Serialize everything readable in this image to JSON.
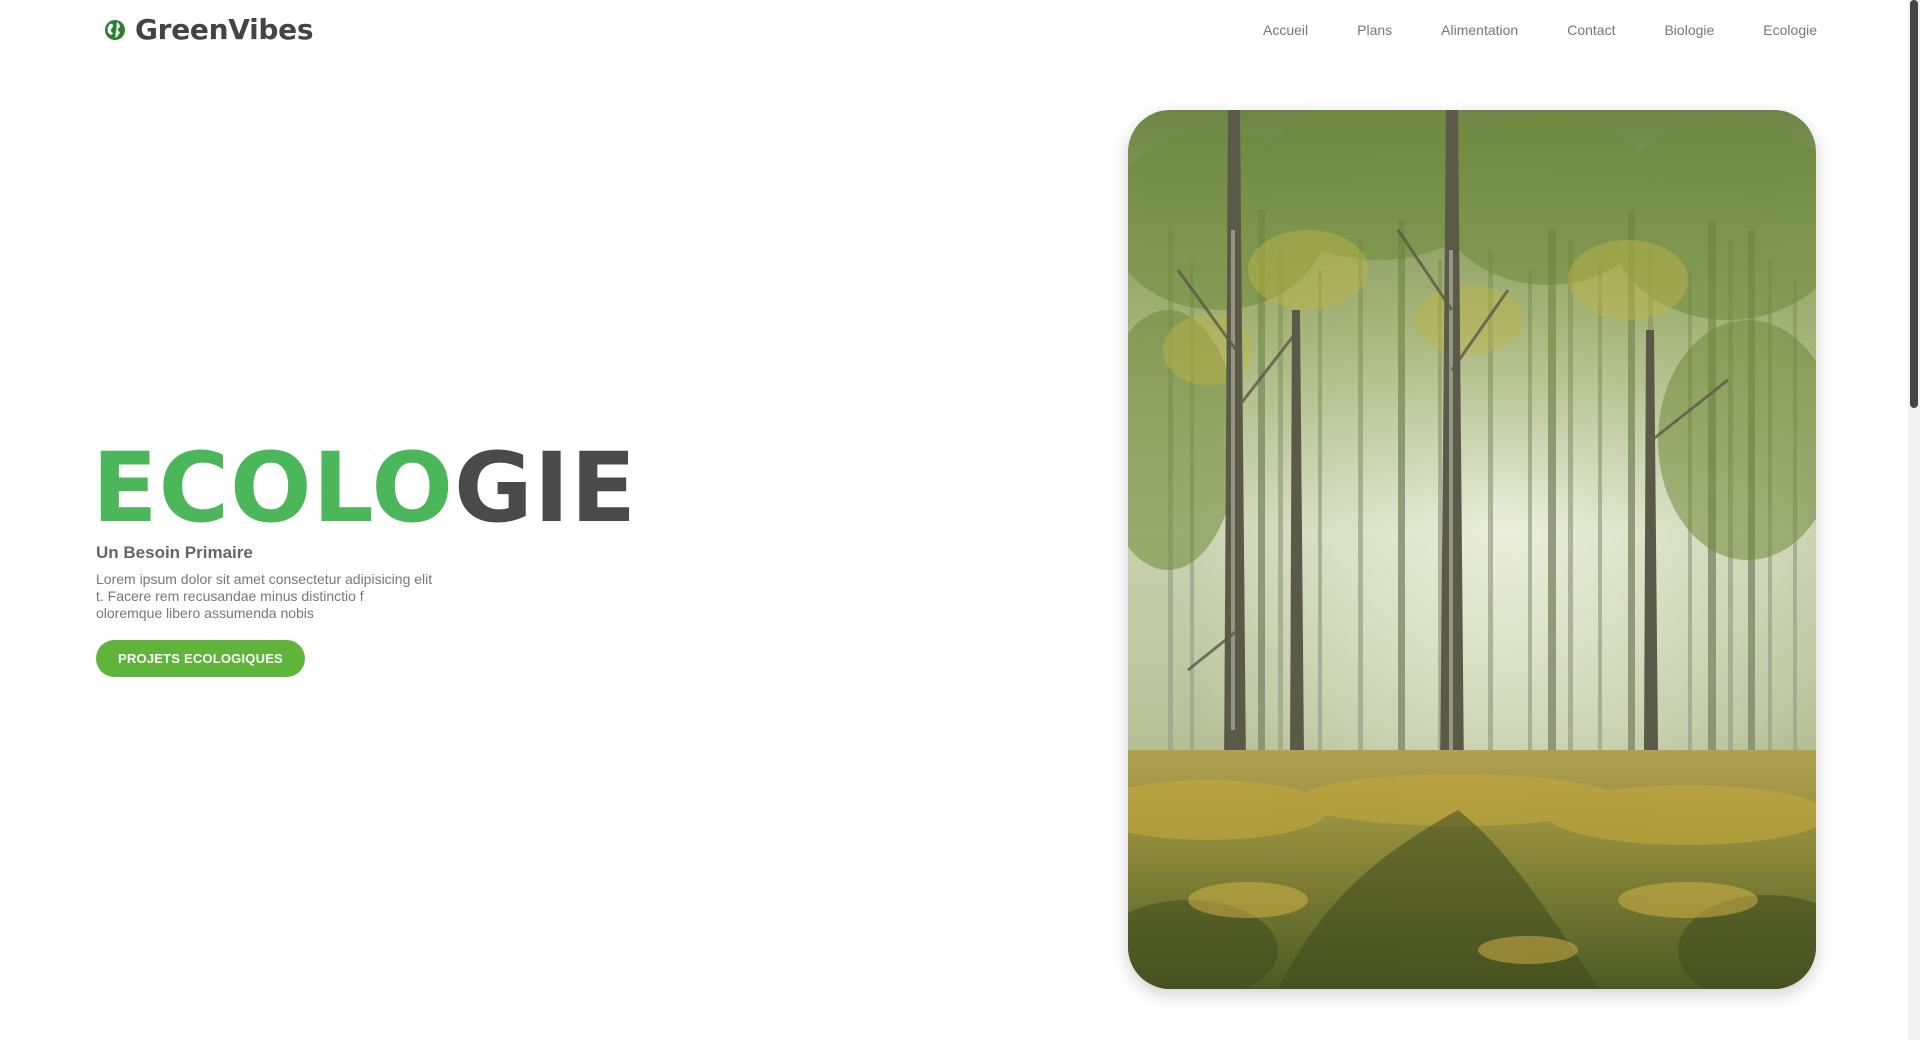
{
  "brand": {
    "name": "GreenVibes",
    "icon": "globe-leaf-icon",
    "colors": {
      "green": "#4cb65a",
      "dark": "#4a4a4a",
      "button": "#5fb43a"
    }
  },
  "nav": {
    "items": [
      {
        "label": "Accueil"
      },
      {
        "label": "Plans"
      },
      {
        "label": "Alimentation"
      },
      {
        "label": "Contact"
      },
      {
        "label": "Biologie"
      },
      {
        "label": "Ecologie"
      }
    ]
  },
  "hero": {
    "title_green": "ECOLO",
    "title_dark": "GIE",
    "subtitle": "Un Besoin Primaire",
    "text_lines": [
      "Lorem ipsum dolor sit amet consectetur adipisicing elit",
      "t. Facere rem recusandae minus distinctio f",
      "oloremque libero assumenda nobis"
    ],
    "cta_label": "PROJETS ECOLOGIQUES",
    "image": "forest-photo"
  }
}
